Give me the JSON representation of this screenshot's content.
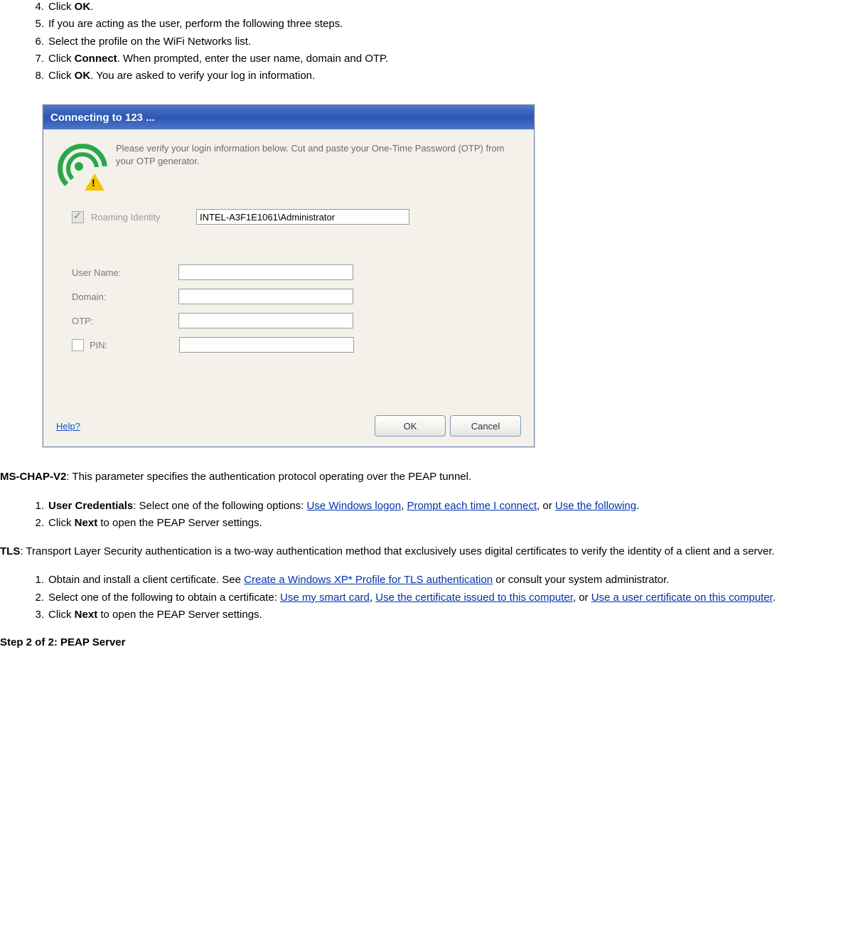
{
  "steps_top": [
    {
      "n": "4.",
      "pre": "Click ",
      "bold": "OK",
      "post": "."
    },
    {
      "n": "5.",
      "pre": "If you are acting as the user, perform the following three steps.",
      "bold": "",
      "post": ""
    },
    {
      "n": "6.",
      "pre": "Select the profile on the WiFi Networks list.",
      "bold": "",
      "post": ""
    },
    {
      "n": "7.",
      "pre": "Click ",
      "bold": "Connect",
      "post": ". When prompted, enter the user name, domain and OTP."
    },
    {
      "n": "8.",
      "pre": "Click ",
      "bold": "OK",
      "post": ". You are asked to verify your log in information."
    }
  ],
  "dialog": {
    "title": "Connecting to 123 ...",
    "intro": "Please verify your login information below. Cut and paste your One-Time Password (OTP) from your OTP generator.",
    "roaming_label": "Roaming Identity",
    "roaming_value": "INTEL-A3F1E1061\\Administrator",
    "labels": {
      "username": "User Name:",
      "domain": "Domain:",
      "otp": "OTP:",
      "pin": "PIN:"
    },
    "buttons": {
      "ok": "OK",
      "cancel": "Cancel"
    },
    "help": "Help?"
  },
  "mschap": {
    "label": "MS-CHAP-V2",
    "desc": ": This parameter specifies the authentication protocol operating over the PEAP tunnel."
  },
  "mschap_steps": {
    "s1_num": "1.",
    "s1_boldlabel": "User Credentials",
    "s1_text_a": ": Select one of the following options: ",
    "s1_link1": "Use Windows logon",
    "s1_sep1": ", ",
    "s1_link2": "Prompt each time I connect",
    "s1_sep2": ", or ",
    "s1_link3": "Use the following",
    "s1_end": ".",
    "s2_num": "2.",
    "s2_pre": "Click ",
    "s2_bold": "Next",
    "s2_post": " to open the PEAP Server settings."
  },
  "tls": {
    "label": "TLS",
    "desc": ": Transport Layer Security authentication is a two-way authentication method that exclusively uses digital certificates to verify the identity of a client and a server."
  },
  "tls_steps": {
    "s1_num": "1.",
    "s1_a": "Obtain and install a client certificate. See ",
    "s1_link": "Create a Windows XP* Profile for TLS authentication",
    "s1_b": " or consult your system administrator.",
    "s2_num": "2.",
    "s2_a": "Select one of the following to obtain a certificate: ",
    "s2_link1": "Use my smart card",
    "s2_sep1": ", ",
    "s2_link2": "Use the certificate issued to this computer",
    "s2_sep2": ", or ",
    "s2_link3": "Use a user certificate on this computer",
    "s2_end": ".",
    "s3_num": "3.",
    "s3_pre": "Click ",
    "s3_bold": "Next",
    "s3_post": " to open the PEAP Server settings."
  },
  "step2_heading": "Step 2 of 2: PEAP Server"
}
